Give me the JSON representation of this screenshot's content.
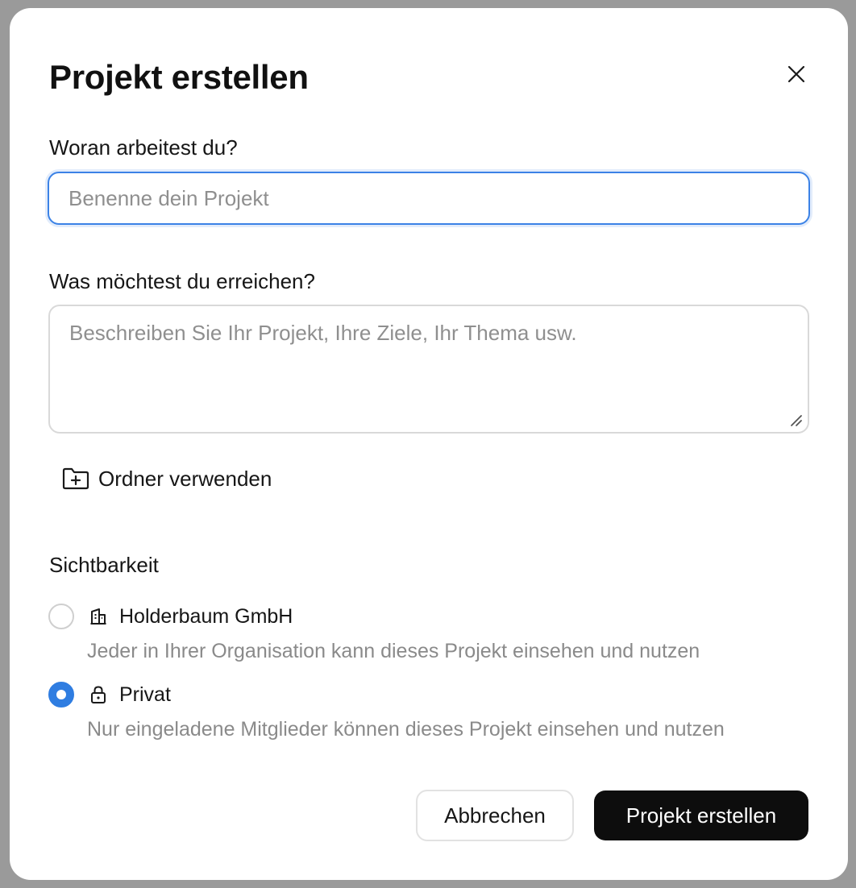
{
  "dialog": {
    "title": "Projekt erstellen",
    "close_icon": "close-icon"
  },
  "name_field": {
    "label": "Woran arbeitest du?",
    "value": "",
    "placeholder": "Benenne dein Projekt"
  },
  "goal_field": {
    "label": "Was möchtest du erreichen?",
    "value": "",
    "placeholder": "Beschreiben Sie Ihr Projekt, Ihre Ziele, Ihr Thema usw."
  },
  "folder": {
    "label": "Ordner verwenden",
    "icon": "folder-plus-icon"
  },
  "visibility": {
    "heading": "Sichtbarkeit",
    "options": [
      {
        "label": "Holderbaum GmbH",
        "description": "Jeder in Ihrer Organisation kann dieses Projekt einsehen und nutzen",
        "icon": "building-icon",
        "selected": false
      },
      {
        "label": "Privat",
        "description": "Nur eingeladene Mitglieder können dieses Projekt einsehen und nutzen",
        "icon": "lock-icon",
        "selected": true
      }
    ]
  },
  "actions": {
    "cancel_label": "Abbrechen",
    "submit_label": "Projekt erstellen"
  },
  "colors": {
    "accent": "#2f7de1",
    "focus_border": "#3b82e6",
    "primary_button": "#0d0d0d",
    "muted_text": "#8a8a8a"
  }
}
